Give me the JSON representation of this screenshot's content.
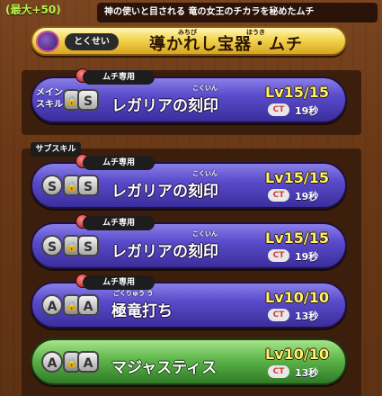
{
  "header": {
    "limit": "(最大+50)",
    "description": "神の使いと目される 竜の女王のチカラを秘めたムチ"
  },
  "trait": {
    "label": "とくせい",
    "name": "導かれし宝器・ムチ",
    "ruby1": "みちび",
    "ruby2": "ほうき"
  },
  "main_skill_label": "メイン\nスキル",
  "sub_skill_label": "サブスキル",
  "skills": [
    {
      "tag": "ムチ専用",
      "name": "レガリアの刻印",
      "ruby": "こくいん",
      "level": "Lv15/15",
      "ct_label": "CT",
      "ct": "19秒",
      "rank": "S"
    },
    {
      "tag": "ムチ専用",
      "name": "レガリアの刻印",
      "ruby": "こくいん",
      "level": "Lv15/15",
      "ct_label": "CT",
      "ct": "19秒",
      "rank": "S"
    },
    {
      "tag": "ムチ専用",
      "name": "レガリアの刻印",
      "ruby": "こくいん",
      "level": "Lv15/15",
      "ct_label": "CT",
      "ct": "19秒",
      "rank": "S"
    },
    {
      "tag": "ムチ専用",
      "name": "極竜打ち",
      "ruby": "ごくりゅう う",
      "level": "Lv10/10",
      "ct_label": "CT",
      "ct": "13秒",
      "rank": "A"
    },
    {
      "tag": "",
      "name": "マジャスティス",
      "ruby": "",
      "level": "Lv10/10",
      "ct_label": "CT",
      "ct": "13秒",
      "rank": "A"
    }
  ],
  "colors": {
    "skill_purple": "#5a4ccb",
    "skill_green": "#5db54a",
    "level_yellow": "#fff36a",
    "trait_gold": "#f3d44e"
  }
}
